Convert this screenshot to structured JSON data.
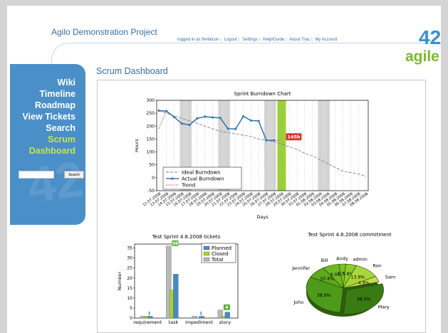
{
  "header": {
    "project_title": "Agilo Demonstration Project",
    "metanav": [
      "logged in as firefalcon",
      "Logout",
      "Settings",
      "Help/Guide",
      "About Trac",
      "My Account"
    ],
    "logo_text": "42 agile"
  },
  "sidebar": {
    "items": [
      {
        "label": "Wiki"
      },
      {
        "label": "Timeline"
      },
      {
        "label": "Roadmap"
      },
      {
        "label": "View Tickets"
      },
      {
        "label": "Search"
      },
      {
        "label": "Scrum"
      },
      {
        "label": "Dashboard"
      }
    ],
    "search_button": "Search",
    "watermark": "42 agile"
  },
  "main": {
    "heading": "Scrum Dashboard"
  },
  "colors": {
    "accent_blue": "#3a6ea5",
    "sidebar_blue": "#4b8fc9",
    "active_green": "#c8e63c",
    "planned_blue": "#4a8ac4",
    "closed_green": "#a9d52a",
    "total_gray": "#b8b8b8"
  },
  "chart_data": [
    {
      "type": "line",
      "title": "Sprint Burndown Chart",
      "xlabel": "Days",
      "ylabel": "Hours",
      "ylim": [
        -50,
        300
      ],
      "yticks": [
        -50,
        0,
        50,
        100,
        150,
        200,
        250,
        300
      ],
      "categories": [
        "12.07.2008",
        "13.07.2008",
        "14.07.2008",
        "15.07.2008",
        "16.07.2008",
        "17.07.2008",
        "18.07.2008",
        "19.07.2008",
        "20.07.2008",
        "21.07.2008",
        "22.07.2008",
        "23.07.2008",
        "24.07.2008",
        "25.07.2008",
        "26.07.2008",
        "27.07.2008",
        "28.07.2008",
        "29.07.2008",
        "30.07.2008",
        "31.07.2008",
        "01.08.2008",
        "02.08.2008",
        "03.08.2008",
        "04.08.2008",
        "05.08.2008",
        "06.08.2008",
        "07.08.2008",
        "08.08.2008"
      ],
      "series": [
        {
          "name": "Ideal Burndown",
          "values": [
            260,
            250,
            240,
            230,
            221,
            211,
            200,
            190,
            180,
            175,
            170,
            165,
            160,
            150,
            145,
            140,
            130,
            120,
            110,
            95,
            85,
            70,
            55,
            40,
            25,
            20,
            15,
            5
          ]
        },
        {
          "name": "Actual Burndown",
          "values": [
            260,
            258,
            235,
            210,
            205,
            230,
            237,
            234,
            232,
            190,
            189,
            238,
            222,
            220,
            145,
            145,
            null,
            null,
            null,
            null,
            null,
            null,
            null,
            null,
            null,
            null,
            null,
            null
          ]
        },
        {
          "name": "Trend",
          "values": [
            190,
            260,
            null,
            null,
            null,
            null,
            null,
            null,
            null,
            null,
            null,
            null,
            null,
            null,
            null,
            145,
            145,
            null,
            null,
            null,
            null,
            null,
            null,
            null,
            null,
            null,
            null,
            null
          ]
        }
      ],
      "annotation": "145h",
      "legend": "bottom-left"
    },
    {
      "type": "bar",
      "title": "Test Sprint 4.8.2008 tickets",
      "ylabel": "Number",
      "ylim": [
        0,
        37
      ],
      "yticks": [
        0,
        5,
        10,
        15,
        20,
        25,
        30,
        35
      ],
      "categories": [
        "requirement",
        "task",
        "impediment",
        "story"
      ],
      "series": [
        {
          "name": "Planned",
          "values": [
            1,
            22,
            1,
            3
          ]
        },
        {
          "name": "Closed",
          "values": [
            1,
            14,
            0,
            1
          ]
        },
        {
          "name": "Total",
          "values": [
            1,
            36,
            1,
            4
          ]
        }
      ],
      "data_labels": [
        "1",
        "36",
        "1",
        "4"
      ],
      "legend": "top-right"
    },
    {
      "type": "pie",
      "title": "Test Sprint 4.8.2008 commitment",
      "labels": [
        "Mary",
        "John",
        "Jennifer",
        "Bill",
        "Andy",
        "admin",
        "Ron",
        "Sam"
      ],
      "values": [
        38.0,
        38.9,
        10.4,
        9.0,
        3.7,
        5.8,
        13.9,
        4.9
      ],
      "value_labels": [
        "38.0%",
        "38.9%",
        "10.4%",
        "9.0%",
        "3.7%",
        "5.8%",
        "13.9%",
        "4.9%"
      ]
    }
  ]
}
